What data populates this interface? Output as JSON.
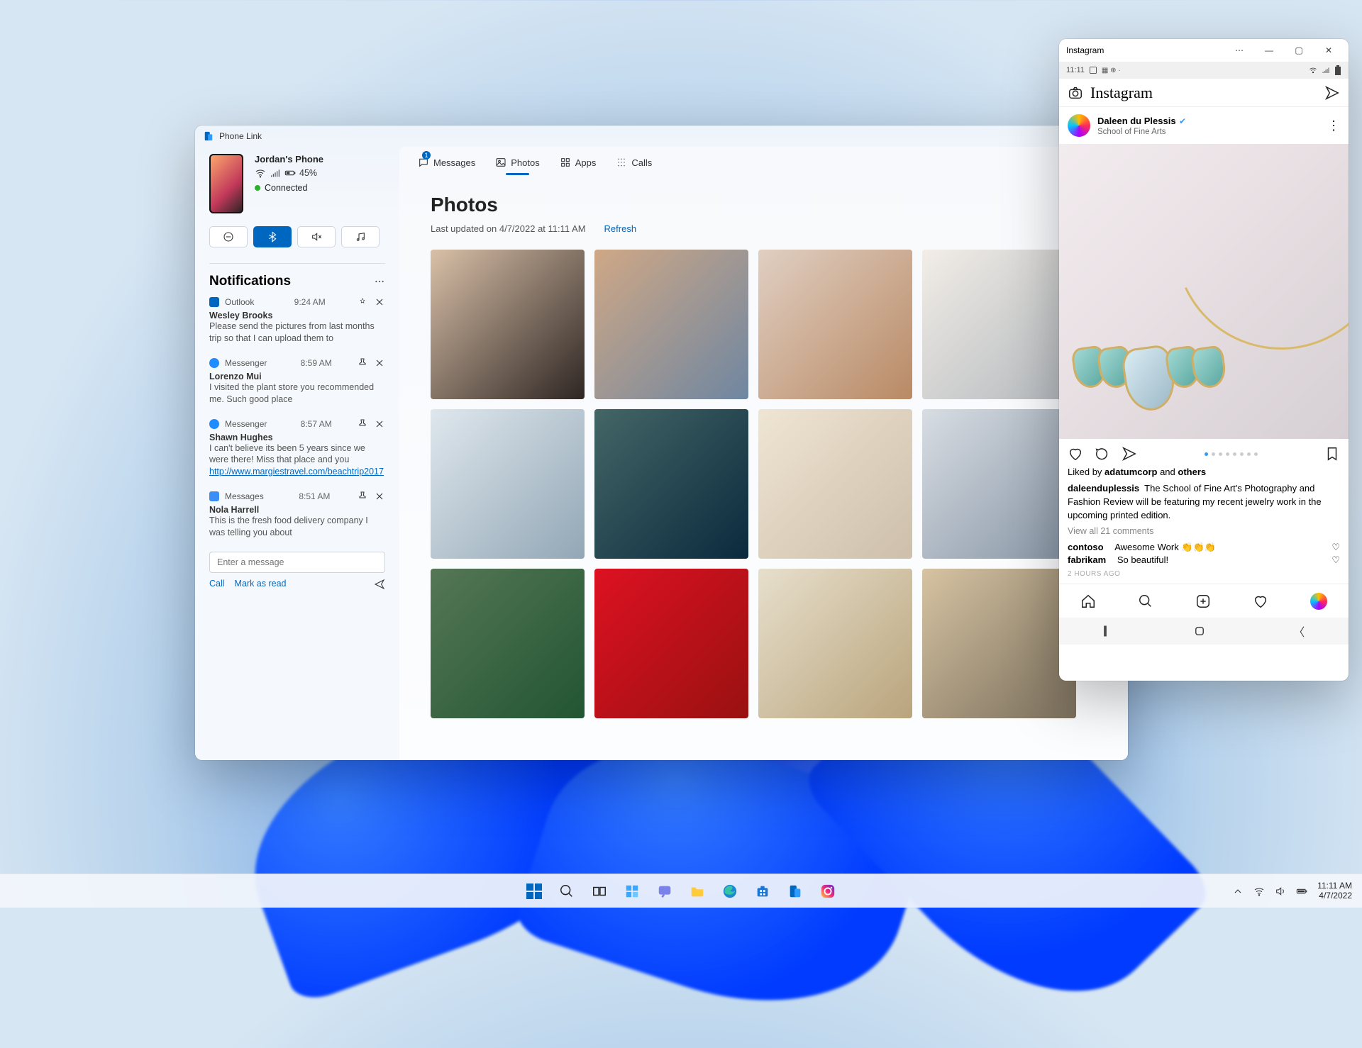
{
  "phonelink": {
    "window_title": "Phone Link",
    "device_name": "Jordan's Phone",
    "battery": "45%",
    "status": "Connected",
    "tabs": {
      "messages": "Messages",
      "photos": "Photos",
      "apps": "Apps",
      "calls": "Calls",
      "messages_badge": "1"
    },
    "page_title": "Photos",
    "last_updated": "Last updated on 4/7/2022 at 11:11 AM",
    "refresh": "Refresh",
    "notifications_title": "Notifications",
    "msg_placeholder": "Enter a message",
    "action_call": "Call",
    "action_markread": "Mark as read",
    "items": [
      {
        "app": "Outlook",
        "time": "9:24 AM",
        "sender": "Wesley Brooks",
        "body": "Please send the pictures from last months trip so that I can upload them to"
      },
      {
        "app": "Messenger",
        "time": "8:59 AM",
        "sender": "Lorenzo Mui",
        "body": "I visited the plant store you recommended me. Such good place"
      },
      {
        "app": "Messenger",
        "time": "8:57 AM",
        "sender": "Shawn Hughes",
        "body": "I can't believe its been 5 years since we were there! Miss that place and you",
        "link": "http://www.margiestravel.com/beachtrip2017"
      },
      {
        "app": "Messages",
        "time": "8:51 AM",
        "sender": "Nola Harrell",
        "body": "This is the fresh food delivery company I was telling you about"
      }
    ]
  },
  "instagram": {
    "window_title": "Instagram",
    "status_time": "11:11",
    "logo": "Instagram",
    "post_user": "Daleen du Plessis",
    "post_sub": "School of Fine Arts",
    "liked_prefix": "Liked by ",
    "liked_strong": "adatumcorp",
    "liked_mid": " and ",
    "liked_others": "others",
    "cap_user": "daleenduplessis",
    "cap_body": "The School of Fine Art's Photography and Fashion Review will be featuring my recent jewelry work in the upcoming printed edition.",
    "view_comments": "View all 21 comments",
    "c1_user": "contoso",
    "c1_body": "Awesome Work 👏👏👏",
    "c2_user": "fabrikam",
    "c2_body": "So beautiful!",
    "time": "2 HOURS AGO"
  },
  "taskbar": {
    "time": "11:11 AM",
    "date": "4/7/2022"
  }
}
